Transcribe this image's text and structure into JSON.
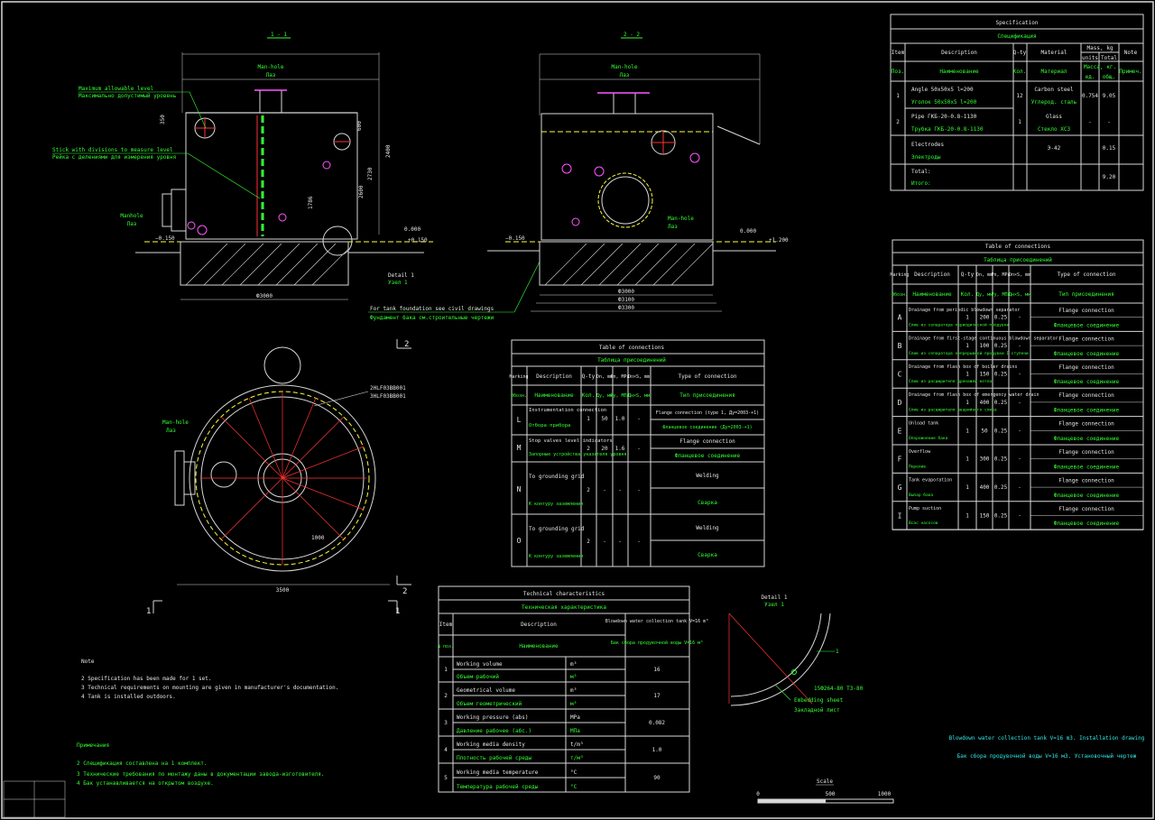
{
  "colors": {
    "background": "#000000",
    "frame": "#d8d8d8",
    "cyan": "#33d6e6",
    "green": "#33ff33",
    "yellow": "#ffff33",
    "magenta": "#ff55ff",
    "red": "#ff3333"
  },
  "views": {
    "section_11": {
      "title": "1 - 1",
      "labels": [
        "Maximum allowable level",
        "Максимально допустимый уровень",
        "Stick with divisions to measure level",
        "Рейка с делениями для измерения уровня",
        "Manhole",
        "Лаз",
        "Man-hole",
        "Лаз"
      ],
      "dims": [
        "−0.150",
        "0.000",
        "+0.150",
        "Ф3000",
        "2400",
        "2730",
        "2600",
        "350",
        "600",
        "1786"
      ],
      "notes": [
        "Detail 1",
        "Узел 1",
        "For tank foundation see civil drawings",
        "Фундамент бака см.строительные чертежи"
      ]
    },
    "section_22": {
      "title": "2 - 2",
      "labels": [
        "Man-hole",
        "Лаз",
        "Man-hole",
        "Лаз"
      ],
      "dims": [
        "−0.150",
        "0.000",
        "+1.200",
        "Ф3000",
        "Ф3100",
        "Ф3300"
      ]
    },
    "plan": {
      "labels": [
        "Man-hole",
        "Лаз",
        "2HLF03BB001",
        "3HLF03BB001"
      ],
      "dims": [
        "3500",
        "1000"
      ],
      "section_marks": [
        "1",
        "1",
        "2",
        "2"
      ]
    }
  },
  "specification": {
    "title": "Specification",
    "title_ru": "Спецификация",
    "headers": [
      "Item",
      "Description",
      "Q-ty",
      "Material",
      "Mass, kg",
      "Note"
    ],
    "mass_sub": [
      "units",
      "Total"
    ],
    "headers_ru": [
      "Поз.",
      "Наименование",
      "Кол.",
      "Материал",
      "Масса, кг.",
      "Примеч."
    ],
    "mass_sub_ru": [
      "ед.",
      "общ."
    ],
    "rows": [
      {
        "item": "1",
        "desc": "Angle 50x50x5  l=200",
        "desc_ru": "Уголок 50х50х5  l=200",
        "qty": "12",
        "material": "Carbon steel",
        "material_ru": "Углерод. сталь",
        "unit": "0.754",
        "total": "9.05",
        "note": ""
      },
      {
        "item": "2",
        "desc": "Pipe ГКБ-20-0.8-1130",
        "desc_ru": "Трубка ГКБ-20-0.8-1130",
        "qty": "1",
        "material": "Glass",
        "material_ru": "Стекло ХС3",
        "unit": "-",
        "total": "-",
        "note": ""
      },
      {
        "item": "",
        "desc": "Electrodes",
        "desc_ru": "Электроды",
        "qty": "",
        "material": "Э-42",
        "material_ru": "",
        "unit": "",
        "total": "0.15",
        "note": ""
      },
      {
        "item": "",
        "desc": "Total:",
        "desc_ru": "Итого:",
        "qty": "",
        "material": "",
        "material_ru": "",
        "unit": "",
        "total": "9.20",
        "note": ""
      }
    ]
  },
  "connections_right": {
    "title": "Table of connections",
    "title_ru": "Таблица присоединений",
    "headers": [
      "Marking",
      "Description",
      "Q-ty",
      "Dn, mm",
      "Pn, MPa",
      "Dn×S, mm",
      "Type of connection"
    ],
    "headers_ru": [
      "Обозн.",
      "Наименование",
      "Кол.",
      "Ду, мм",
      "Ру, МПа",
      "Дн×S, мм",
      "Тип присоединения"
    ],
    "rows": [
      {
        "mark": "A",
        "desc": "Drainage from periodic blowdown separator",
        "desc_ru": "Слив из сепаратора периодической продувки",
        "qty": "1",
        "dn": "200",
        "pn": "0.25",
        "dns": "-",
        "type": "Flange connection",
        "type_ru": "Фланцевое соединение"
      },
      {
        "mark": "B",
        "desc": "Drainage from first-stage continuous blowdown separator",
        "desc_ru": "Слив из сепаратора непрерывной продувки I ступени",
        "qty": "1",
        "dn": "100",
        "pn": "0.25",
        "dns": "-",
        "type": "Flange connection",
        "type_ru": "Фланцевое соединение"
      },
      {
        "mark": "C",
        "desc": "Drainage from flash box of boiler drains",
        "desc_ru": "Слив из расширителя дренажей котла",
        "qty": "1",
        "dn": "150",
        "pn": "0.25",
        "dns": "-",
        "type": "Flange connection",
        "type_ru": "Фланцевое соединение"
      },
      {
        "mark": "D",
        "desc": "Drainage from flash box of emergency water drain",
        "desc_ru": "Слив из расширителя аварийного слива",
        "qty": "1",
        "dn": "400",
        "pn": "0.25",
        "dns": "-",
        "type": "Flange connection",
        "type_ru": "Фланцевое соединение"
      },
      {
        "mark": "E",
        "desc": "Unload tank",
        "desc_ru": "Опорожнение бака",
        "qty": "1",
        "dn": "50",
        "pn": "0.25",
        "dns": "-",
        "type": "Flange connection",
        "type_ru": "Фланцевое соединение"
      },
      {
        "mark": "F",
        "desc": "Overflow",
        "desc_ru": "Перелив",
        "qty": "1",
        "dn": "300",
        "pn": "0.25",
        "dns": "-",
        "type": "Flange connection",
        "type_ru": "Фланцевое соединение"
      },
      {
        "mark": "G",
        "desc": "Tank evaporation",
        "desc_ru": "Выпар бака",
        "qty": "1",
        "dn": "400",
        "pn": "0.25",
        "dns": "-",
        "type": "Flange connection",
        "type_ru": "Фланцевое соединение"
      },
      {
        "mark": "I",
        "desc": "Pump suction",
        "desc_ru": "Всас насосов",
        "qty": "1",
        "dn": "150",
        "pn": "0.25",
        "dns": "-",
        "type": "Flange connection",
        "type_ru": "Фланцевое соединение"
      }
    ]
  },
  "connections_mid": {
    "title": "Table of connections",
    "title_ru": "Таблица присоединений",
    "headers": [
      "Marking",
      "Description",
      "Q-ty",
      "Dn, mm",
      "Pn, MPa",
      "Dn×S, mm",
      "Type of connection"
    ],
    "headers_ru": [
      "Обозн.",
      "Наименование",
      "Кол.",
      "Ду, мм",
      "Ру, МПа",
      "Дн×S, мм",
      "Тип присоединения"
    ],
    "rows": [
      {
        "mark": "L",
        "desc": "Instrumentation connection",
        "desc_ru": "Отбора прибора",
        "qty": "1",
        "dn": "50",
        "pn": "1.0",
        "dns": "-",
        "type": "Flange connection (type 1, Ду=2003-+1)",
        "type_ru": "Фланцевое соединение (Ду=2003-+1)"
      },
      {
        "mark": "M",
        "desc": "Stop valves level indicators",
        "desc_ru": "Запорные устройства указателя уровня",
        "qty": "2",
        "dn": "20",
        "pn": "1.6",
        "dns": "-",
        "type": "Flange connection",
        "type_ru": "Фланцевое соединение"
      },
      {
        "mark": "N",
        "desc": "To grounding grid",
        "desc_ru": "К контуру заземления",
        "qty": "2",
        "dn": "-",
        "pn": "-",
        "dns": "-",
        "type": "Welding",
        "type_ru": "Сварка"
      },
      {
        "mark": "O",
        "desc": "To grounding grid",
        "desc_ru": "К контуру заземления",
        "qty": "2",
        "dn": "-",
        "pn": "-",
        "dns": "-",
        "type": "Welding",
        "type_ru": "Сварка"
      }
    ]
  },
  "technical": {
    "title": "Technical characteristics",
    "title_ru": "Техническая характеристика",
    "headers": [
      "Item",
      "Description",
      "",
      "Blowdown water collection tank V=16 m³"
    ],
    "headers_ru": [
      "№ поз.",
      "Наименование",
      "",
      "Бак сбора продувочной воды V=16 м³"
    ],
    "rows": [
      {
        "n": "1",
        "desc": "Working volume",
        "desc_ru": "Объем рабочий",
        "unit": "m³",
        "unit_ru": "м³",
        "val": "16"
      },
      {
        "n": "2",
        "desc": "Geometrical volume",
        "desc_ru": "Объем геометрический",
        "unit": "m³",
        "unit_ru": "м³",
        "val": "17"
      },
      {
        "n": "3",
        "desc": "Working pressure (abs)",
        "desc_ru": "Давление рабочее (абс.)",
        "unit": "MPa",
        "unit_ru": "МПа",
        "val": "0.082"
      },
      {
        "n": "4",
        "desc": "Working media density",
        "desc_ru": "Плотность рабочей среды",
        "unit": "t/m³",
        "unit_ru": "т/м³",
        "val": "1.0"
      },
      {
        "n": "5",
        "desc": "Working media temperature",
        "desc_ru": "Температура рабочей среды",
        "unit": "°C",
        "unit_ru": "°С",
        "val": "90"
      }
    ]
  },
  "detail": {
    "title": "Detail 1",
    "title_ru": "Узел 1",
    "labels": [
      "1",
      "15Ф264-80 ТЗ-80",
      "Embedding sheet",
      "Закладной лист"
    ]
  },
  "notes_en": {
    "title": "Note",
    "items": [
      "2 Specification has been made for 1 set.",
      "3 Technical requirements on mounting are given in manufacturer's documentation.",
      "4 Tank is installed outdoors."
    ]
  },
  "notes_ru": {
    "title": "Примечания",
    "items": [
      "2 Спецификация составлена на 1 комплект.",
      "3 Технические требования по монтажу даны в документации завода-изготовителя.",
      "4 Бак устанавливается на открытом воздухе."
    ]
  },
  "title_block": {
    "en": "Blowdown water collection tank V=16 m3. Installation drawing",
    "ru": "Бак сбора продувочной воды V=16 м3. Установочный чертеж"
  },
  "scale": {
    "title": "Scale",
    "ticks": [
      "0",
      "500",
      "1000"
    ]
  }
}
